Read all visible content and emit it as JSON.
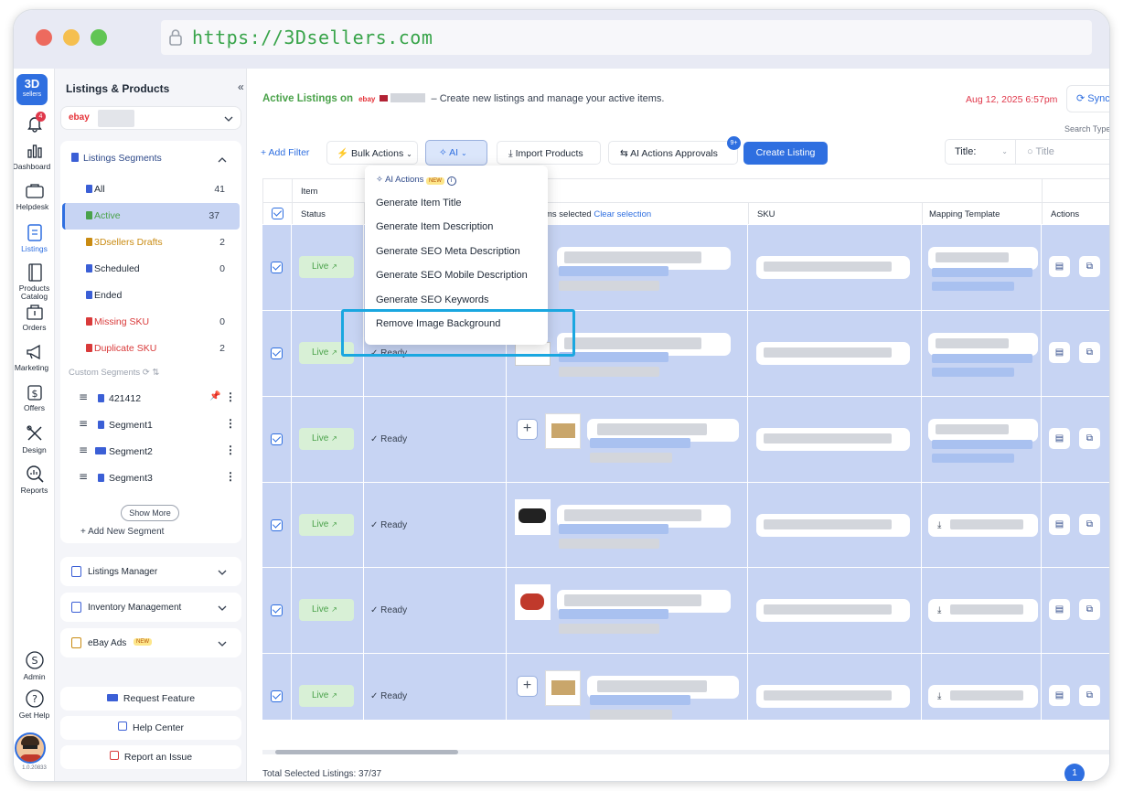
{
  "browser": {
    "url": "https://3Dsellers.com"
  },
  "rail": {
    "logo": "3D sellers",
    "notif_badge": "4",
    "items": [
      {
        "label": "Dashboard",
        "icon": "chart-bars-icon"
      },
      {
        "label": "Helpdesk",
        "icon": "helpdesk-icon"
      },
      {
        "label": "Listings",
        "icon": "clipboard-icon"
      },
      {
        "label": "Products\nCatalog",
        "icon": "catalog-icon"
      },
      {
        "label": "Orders",
        "icon": "orders-icon"
      },
      {
        "label": "Marketing",
        "icon": "megaphone-icon"
      },
      {
        "label": "Offers",
        "icon": "dollar-icon"
      },
      {
        "label": "Design",
        "icon": "design-icon"
      },
      {
        "label": "Reports",
        "icon": "reports-icon"
      },
      {
        "label": "Admin",
        "icon": "admin-icon"
      },
      {
        "label": "Get Help",
        "icon": "help-icon"
      }
    ],
    "version": "1.0.20833"
  },
  "sidebar": {
    "title": "Listings & Products",
    "store_label": "ebay",
    "segments_header": "Listings Segments",
    "segments": [
      {
        "label": "All",
        "count": "41",
        "color": "#1f2937"
      },
      {
        "label": "Active",
        "count": "37",
        "color": "#4aa24a"
      },
      {
        "label": "3Dsellers Drafts",
        "count": "2",
        "color": "#c98b12"
      },
      {
        "label": "Scheduled",
        "count": "0",
        "color": "#1f2937"
      },
      {
        "label": "Ended",
        "count": "",
        "color": "#1f2937"
      },
      {
        "label": "Missing SKU",
        "count": "0",
        "color": "#d93a3a"
      },
      {
        "label": "Duplicate SKU",
        "count": "2",
        "color": "#d93a3a"
      }
    ],
    "custom_header": "Custom Segments",
    "custom_segments": [
      {
        "label": "421412"
      },
      {
        "label": "Segment1"
      },
      {
        "label": "Segment2"
      },
      {
        "label": "Segment3"
      }
    ],
    "show_more": "Show More",
    "add_segment": "+ Add New Segment",
    "sections": [
      {
        "label": "Listings Manager"
      },
      {
        "label": "Inventory Management"
      },
      {
        "label": "eBay Ads",
        "badge": "NEW"
      }
    ],
    "footer_buttons": [
      {
        "label": "Request Feature"
      },
      {
        "label": "Help Center"
      },
      {
        "label": "Report an Issue"
      }
    ]
  },
  "header": {
    "title": "Active Listings on",
    "store": "ebay",
    "subtitle": "– Create new listings and manage your active items.",
    "timestamp": "Aug 12, 2025 6:57pm",
    "sync": "Sync"
  },
  "toolbar": {
    "add_filter": "+ Add Filter",
    "bulk_actions": "Bulk Actions",
    "ai": "AI",
    "import_products": "Import Products",
    "ai_approvals": "AI Actions Approvals",
    "approvals_badge": "9+",
    "create_listing": "Create Listing",
    "search_type_label": "Search Type",
    "search_select": "Title:",
    "search_placeholder": "Title"
  },
  "ai_menu": {
    "header": "AI Actions",
    "badge": "NEW",
    "items": [
      "Generate Item Title",
      "Generate Item Description",
      "Generate SEO Meta Description",
      "Generate SEO Mobile Description",
      "Generate SEO Keywords",
      "Remove Image Background"
    ]
  },
  "table": {
    "header_item": "Item",
    "columns": [
      "Status",
      "ms selected",
      "SKU",
      "Mapping Template",
      "Actions"
    ],
    "clear_selection": "Clear selection",
    "rows": [
      {
        "status": "Live",
        "ready": ""
      },
      {
        "status": "Live",
        "ready": "Ready"
      },
      {
        "status": "Live",
        "ready": "Ready"
      },
      {
        "status": "Live",
        "ready": "Ready"
      },
      {
        "status": "Live",
        "ready": "Ready"
      },
      {
        "status": "Live",
        "ready": "Ready"
      }
    ],
    "footer": "Total Selected Listings: 37/37",
    "page": "1"
  },
  "colors": {
    "accent": "#2f6fe0",
    "highlight": "#1aa7e0",
    "live": "#4aa24a",
    "date": "#e0384b"
  }
}
